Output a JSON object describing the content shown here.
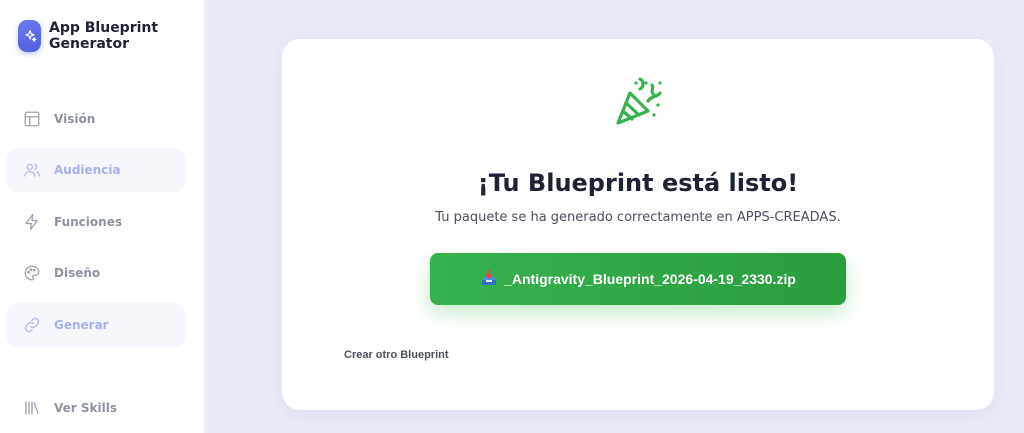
{
  "brand": {
    "title": "App Blueprint Generator"
  },
  "sidebar": {
    "items": [
      {
        "label": "Visión",
        "icon": "layout-icon",
        "active": false
      },
      {
        "label": "Audiencia",
        "icon": "users-icon",
        "active": true
      },
      {
        "label": "Funciones",
        "icon": "lightning-icon",
        "active": false
      },
      {
        "label": "Diseño",
        "icon": "palette-icon",
        "active": false
      },
      {
        "label": "Generar",
        "icon": "link-icon",
        "active": true
      }
    ],
    "footer": {
      "label": "Ver Skills",
      "icon": "library-icon"
    }
  },
  "result": {
    "icon": "party-popper-icon",
    "title": "¡Tu Blueprint está listo!",
    "subtitle": "Tu paquete se ha generado correctamente en APPS-CREADAS.",
    "download_label": "_Antigravity_Blueprint_2026-04-19_2330.zip",
    "download_icon": "inbox-tray-icon",
    "secondary_label": "Crear otro Blueprint"
  },
  "colors": {
    "accent": "#5b6bec",
    "success": "#37b24d",
    "background": "#eaecf8"
  }
}
